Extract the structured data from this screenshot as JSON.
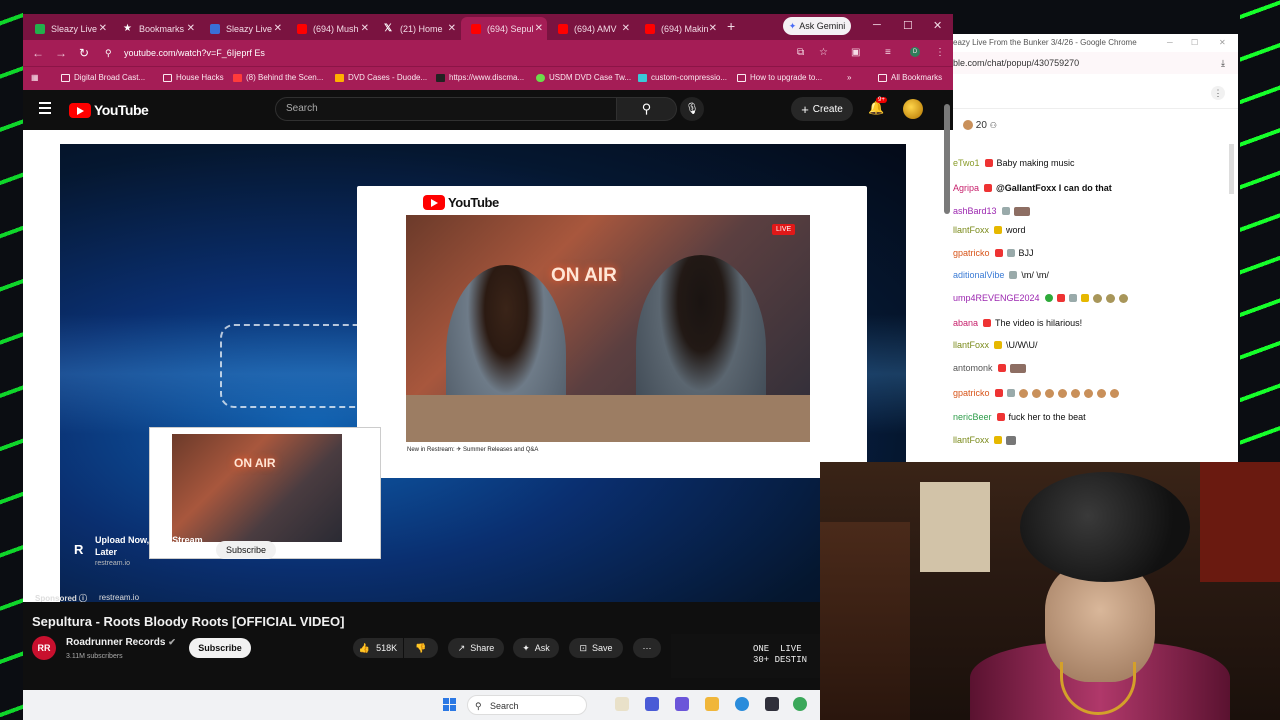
{
  "browser": {
    "tabs": [
      {
        "label": "Sleazy Live",
        "color": "#22b14c",
        "active": false
      },
      {
        "label": "Bookmarks",
        "color": "#ffffff",
        "active": false
      },
      {
        "label": "Sleazy Live",
        "color": "#3a6fd8",
        "active": false
      },
      {
        "label": "(694) Mush",
        "color": "#ff0000",
        "active": false
      },
      {
        "label": "(21) Home",
        "color": "#111111",
        "active": false
      },
      {
        "label": "(694) Sepul",
        "color": "#ff0000",
        "active": true
      },
      {
        "label": "(694) AMV",
        "color": "#ff0000",
        "active": false
      },
      {
        "label": "(694) Makin",
        "color": "#ff0000",
        "active": false
      }
    ],
    "new_tab": "+",
    "ask_gemini": "Ask Gemini",
    "url": "youtube.com/watch?v=F_6Ijeprf Es",
    "bookmarks": [
      "Digital Broad Cast...",
      "House Hacks",
      "(8) Behind the Scen...",
      "DVD Cases - Duode...",
      "https://www.discma...",
      "USDM DVD Case Tw...",
      "custom-compressio...",
      "How to upgrade to..."
    ],
    "all_bookmarks": "All Bookmarks"
  },
  "youtube": {
    "logo": "YouTube",
    "search_placeholder": "Search",
    "create": "Create",
    "notif_badge": "9+"
  },
  "video": {
    "card_logo": "YouTube",
    "on_air": "ON AIR",
    "live": "LIVE",
    "card_caption": "New in Restream: ✈ Summer Releases and Q&A",
    "ad": {
      "title": "Upload Now, Live Stream Later",
      "domain": "restream.io",
      "subscribe": "Subscribe",
      "sponsored": "Sponsored",
      "sponsored_domain": "restream.io"
    }
  },
  "below": {
    "title": "Sepultura - Roots Bloody Roots [OFFICIAL VIDEO]",
    "channel_initials": "RR",
    "channel": "Roadrunner Records",
    "subscribers": "3.11M subscribers",
    "subscribe": "Subscribe",
    "likes": "518K",
    "share": "Share",
    "ask": "Ask",
    "save": "Save",
    "ad_panel_text": "ONE  LIVE\n30+ DESTIN"
  },
  "taskbar": {
    "search": "Search"
  },
  "chat": {
    "window_title": "eazy Live From the Bunker 3/4/26 - Google Chrome",
    "url": "ble.com/chat/popup/430759270",
    "viewers": "20",
    "messages": [
      {
        "author": "eTwo1",
        "color": "#8a9c2a",
        "badge": "#e33",
        "text": "Baby making music"
      },
      {
        "author": "Agripa",
        "color": "#c71f6b",
        "badge": "#e33",
        "text": "@GallantFoxx I can do that"
      },
      {
        "author": "ashBard13",
        "color": "#9c27b0",
        "badge": "#9aa",
        "text": ""
      },
      {
        "author": "llantFoxx",
        "color": "#7a8a1a",
        "badge": "#e6b800",
        "text": "word"
      },
      {
        "author": "gpatricko",
        "color": "#d8551a",
        "badge": "#e33",
        "text": "BJJ"
      },
      {
        "author": "aditionalVibe",
        "color": "#3a7bd5",
        "badge": "#9aa",
        "text": "\\m/ \\m/"
      },
      {
        "author": "ump4REVENGE2024",
        "color": "#9c27b0",
        "badge": "#2eaa3a",
        "text": ""
      },
      {
        "author": "abana",
        "color": "#c71f6b",
        "badge": "#e33",
        "text": "The video is hilarious!"
      },
      {
        "author": "llantFoxx",
        "color": "#7a8a1a",
        "badge": "#e6b800",
        "text": "\\U/W\\U/"
      },
      {
        "author": "antomonk",
        "color": "#555555",
        "badge": "#e33",
        "text": ""
      },
      {
        "author": "gpatricko",
        "color": "#d8551a",
        "badge": "#e33",
        "text": ""
      },
      {
        "author": "nericBeer",
        "color": "#2e9d4a",
        "badge": "#e33",
        "text": "fuck her to the beat"
      },
      {
        "author": "llantFoxx",
        "color": "#7a8a1a",
        "badge": "#e6b800",
        "text": ""
      }
    ]
  }
}
